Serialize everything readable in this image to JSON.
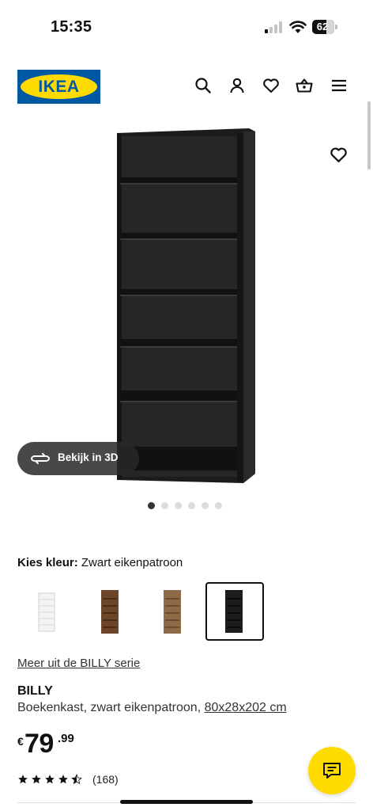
{
  "status_bar": {
    "time": "15:35",
    "battery": "62"
  },
  "header": {
    "logo_text": "IKEA"
  },
  "gallery": {
    "view_3d_label": "Bekijk in 3D",
    "dot_count": 6,
    "active_dot": 1
  },
  "color": {
    "label": "Kies kleur:",
    "value": "Zwart eikenpatroon",
    "swatches": [
      "wit",
      "bruin",
      "eiken",
      "zwart"
    ],
    "selected_index": 4
  },
  "series_link": "Meer uit de BILLY serie",
  "product": {
    "name": "BILLY",
    "description": "Boekenkast, zwart eikenpatroon,",
    "dimensions": "80x28x202 cm"
  },
  "price": {
    "currency": "€",
    "integer": "79",
    "decimals": ".99"
  },
  "rating": {
    "stars": 4.5,
    "count": "(168)"
  },
  "colors": {
    "brand_blue": "#0058a3",
    "brand_yellow": "#ffdb00"
  },
  "icons": [
    "search-icon",
    "user-icon",
    "heart-icon",
    "basket-icon",
    "menu-icon",
    "rotate-3d-icon",
    "chat-icon"
  ]
}
